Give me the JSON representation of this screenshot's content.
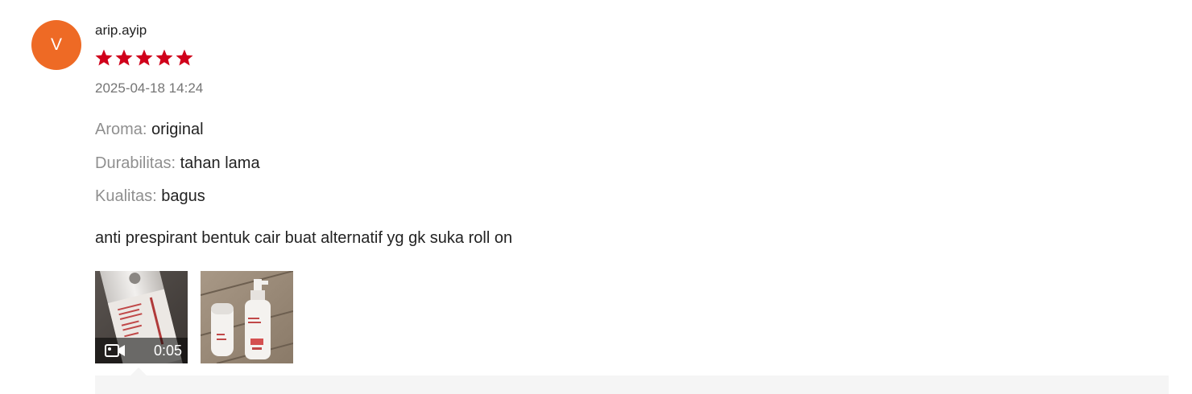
{
  "review": {
    "avatar_initial": "V",
    "username": "arip.ayip",
    "rating": 5,
    "rating_max": 5,
    "star_color": "#d0011b",
    "datetime": "2025-04-18 14:24",
    "attributes": [
      {
        "label": "Aroma:",
        "value": "original"
      },
      {
        "label": "Durabilitas:",
        "value": "tahan lama"
      },
      {
        "label": "Kualitas:",
        "value": "bagus"
      }
    ],
    "comment": "anti prespirant bentuk cair buat alternatif yg gk suka roll on",
    "media": [
      {
        "type": "video",
        "duration": "0:05",
        "icon": "video-camera-icon"
      },
      {
        "type": "image"
      }
    ]
  },
  "colors": {
    "avatar_bg": "#ee6a25",
    "label_gray": "#8f8f8f",
    "text_dark": "#222222",
    "panel_bg": "#f5f5f5"
  }
}
